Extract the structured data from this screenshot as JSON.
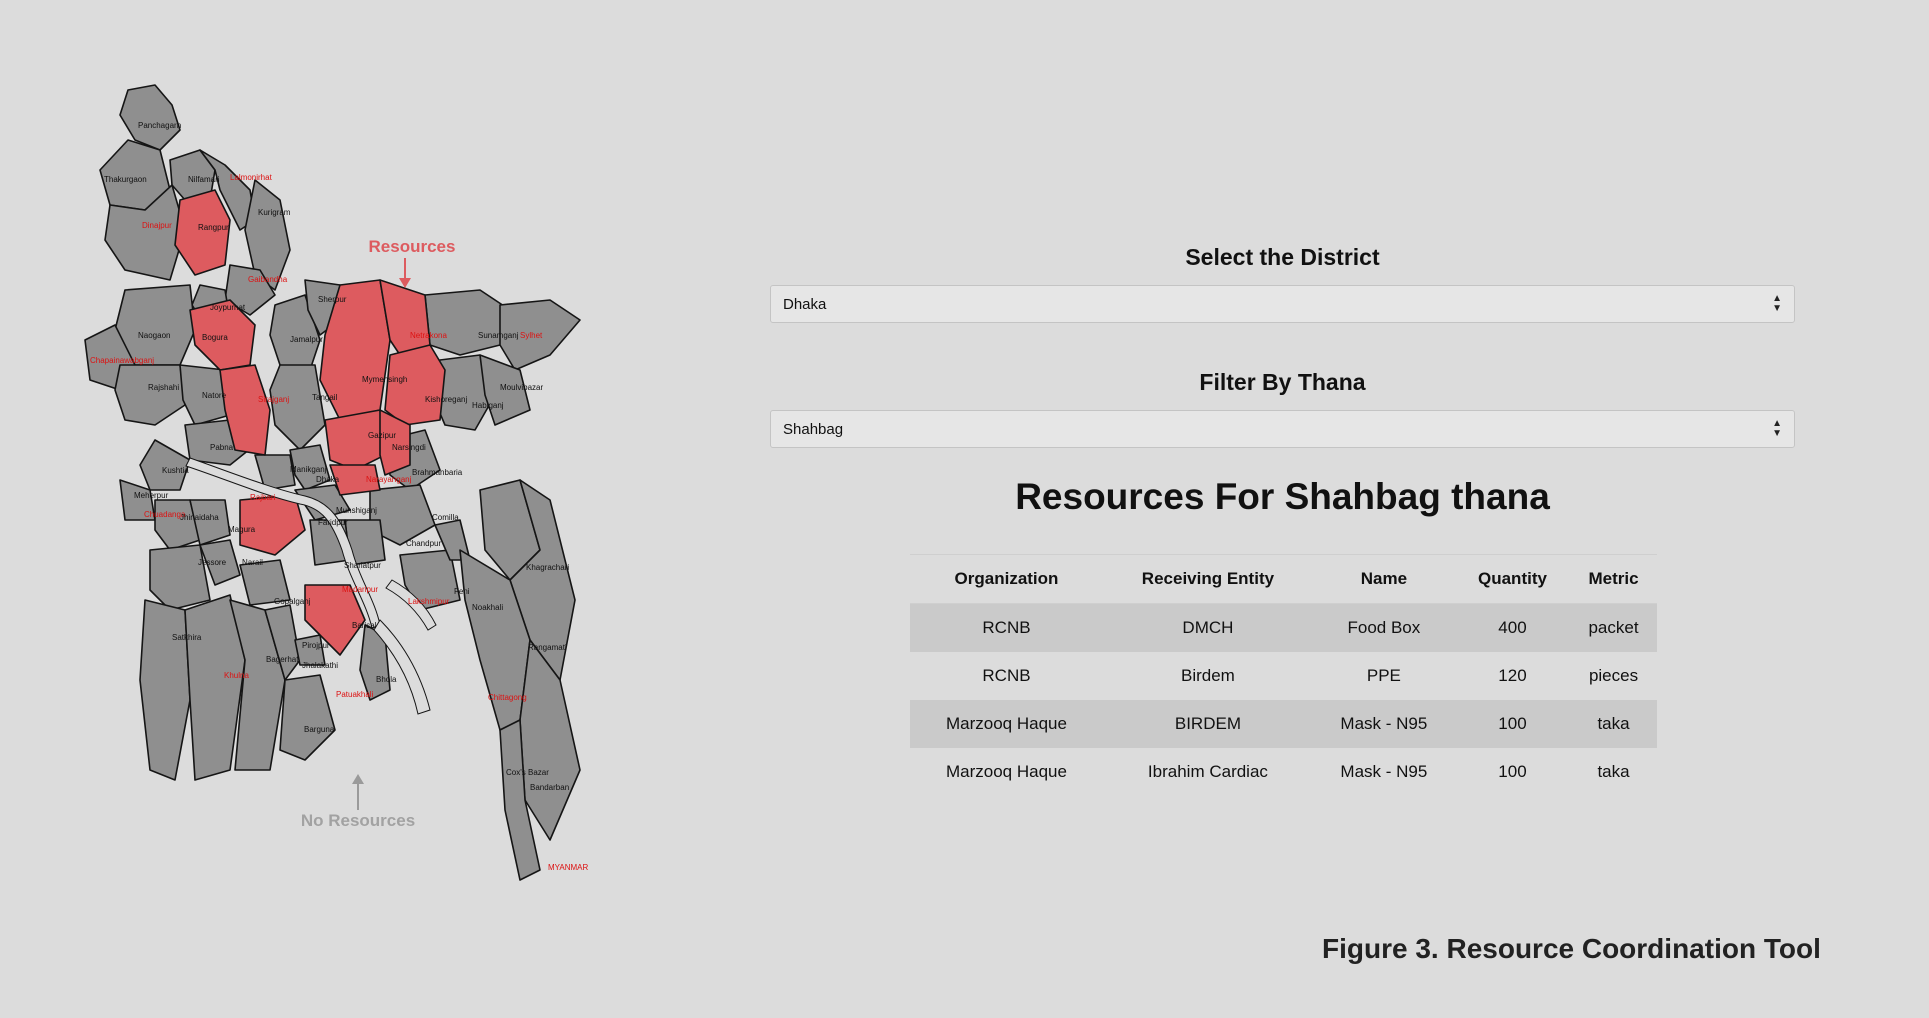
{
  "map": {
    "annotation_resources": "Resources",
    "annotation_no_resources": "No Resources",
    "colors": {
      "resources": "#dd5b5f",
      "no_resources": "#8f8f8f",
      "border": "#151515"
    },
    "district_labels": [
      {
        "name": "Panchagarh",
        "highlighted": false
      },
      {
        "name": "Thakurgaon",
        "highlighted": false
      },
      {
        "name": "Nilfamari",
        "highlighted": false
      },
      {
        "name": "Lalmonirhat",
        "highlighted": true
      },
      {
        "name": "Dinajpur",
        "highlighted": true
      },
      {
        "name": "Rangpur",
        "highlighted": false
      },
      {
        "name": "Kurigram",
        "highlighted": false
      },
      {
        "name": "Gaibandha",
        "highlighted": true
      },
      {
        "name": "Joypurhat",
        "highlighted": false
      },
      {
        "name": "Naogaon",
        "highlighted": false
      },
      {
        "name": "Bogura",
        "highlighted": false
      },
      {
        "name": "Jamalpur",
        "highlighted": false
      },
      {
        "name": "Sherpur",
        "highlighted": false
      },
      {
        "name": "Netrakona",
        "highlighted": true
      },
      {
        "name": "Sunamganj",
        "highlighted": false
      },
      {
        "name": "Sylhet",
        "highlighted": true
      },
      {
        "name": "Chapainawabganj",
        "highlighted": true
      },
      {
        "name": "Rajshahi",
        "highlighted": false
      },
      {
        "name": "Natore",
        "highlighted": false
      },
      {
        "name": "Sirajganj",
        "highlighted": true
      },
      {
        "name": "Tangail",
        "highlighted": false
      },
      {
        "name": "Mymensingh",
        "highlighted": false
      },
      {
        "name": "Kishoreganj",
        "highlighted": false
      },
      {
        "name": "Habiganj",
        "highlighted": false
      },
      {
        "name": "Moulvibazar",
        "highlighted": false
      },
      {
        "name": "Pabna",
        "highlighted": false
      },
      {
        "name": "Gazipur",
        "highlighted": false
      },
      {
        "name": "Narsingdi",
        "highlighted": false
      },
      {
        "name": "Brahmanbaria",
        "highlighted": false
      },
      {
        "name": "Kushtia",
        "highlighted": false
      },
      {
        "name": "Manikganj",
        "highlighted": false
      },
      {
        "name": "Dhaka",
        "highlighted": false
      },
      {
        "name": "Narayanganj",
        "highlighted": true
      },
      {
        "name": "Meherpur",
        "highlighted": false
      },
      {
        "name": "Rajbari",
        "highlighted": true
      },
      {
        "name": "Chuadanga",
        "highlighted": true
      },
      {
        "name": "Jhinaidaha",
        "highlighted": false
      },
      {
        "name": "Faridpur",
        "highlighted": false
      },
      {
        "name": "Munshiganj",
        "highlighted": false
      },
      {
        "name": "Comilla",
        "highlighted": false
      },
      {
        "name": "Magura",
        "highlighted": false
      },
      {
        "name": "Chandpur",
        "highlighted": false
      },
      {
        "name": "Shariatpur",
        "highlighted": false
      },
      {
        "name": "Jessore",
        "highlighted": false
      },
      {
        "name": "Narail",
        "highlighted": false
      },
      {
        "name": "Madaripur",
        "highlighted": true
      },
      {
        "name": "Khagrachari",
        "highlighted": false
      },
      {
        "name": "Gopalganj",
        "highlighted": false
      },
      {
        "name": "Feni",
        "highlighted": false
      },
      {
        "name": "Lakshmipur",
        "highlighted": true
      },
      {
        "name": "Noakhali",
        "highlighted": false
      },
      {
        "name": "Barisal",
        "highlighted": false
      },
      {
        "name": "Satkhira",
        "highlighted": false
      },
      {
        "name": "Pirojpur",
        "highlighted": false
      },
      {
        "name": "Rangamati",
        "highlighted": false
      },
      {
        "name": "Bagerhat",
        "highlighted": false
      },
      {
        "name": "Jhalakathi",
        "highlighted": false
      },
      {
        "name": "Khulna",
        "highlighted": true
      },
      {
        "name": "Bhola",
        "highlighted": false
      },
      {
        "name": "Chittagong",
        "highlighted": true
      },
      {
        "name": "Patuakhali",
        "highlighted": true
      },
      {
        "name": "Barguna",
        "highlighted": false
      },
      {
        "name": "Cox's Bazar",
        "highlighted": false
      },
      {
        "name": "Bandarban",
        "highlighted": false
      },
      {
        "name": "MYANMAR",
        "highlighted": true
      }
    ]
  },
  "district_select": {
    "label": "Select the District",
    "value": "Dhaka"
  },
  "thana_select": {
    "label": "Filter By Thana",
    "value": "Shahbag"
  },
  "resources": {
    "heading": "Resources For Shahbag thana",
    "columns": [
      "Organization",
      "Receiving Entity",
      "Name",
      "Quantity",
      "Metric"
    ],
    "rows": [
      [
        "RCNB",
        "DMCH",
        "Food Box",
        "400",
        "packet"
      ],
      [
        "RCNB",
        "Birdem",
        "PPE",
        "120",
        "pieces"
      ],
      [
        "Marzooq Haque",
        "BIRDEM",
        "Mask - N95",
        "100",
        "taka"
      ],
      [
        "Marzooq Haque",
        "Ibrahim Cardiac",
        "Mask - N95",
        "100",
        "taka"
      ]
    ]
  },
  "caption": "Figure 3. Resource Coordination Tool"
}
